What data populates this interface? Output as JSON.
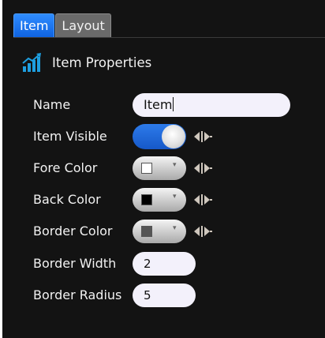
{
  "tabs": [
    {
      "label": "Item",
      "active": true
    },
    {
      "label": "Layout",
      "active": false
    }
  ],
  "section": {
    "title": "Item Properties",
    "icon": "chart-icon"
  },
  "fields": {
    "name": {
      "label": "Name",
      "value": "Item"
    },
    "item_visible": {
      "label": "Item Visible",
      "checked": true
    },
    "fore_color": {
      "label": "Fore Color",
      "color": "#ffffff"
    },
    "back_color": {
      "label": "Back Color",
      "color": "#000000"
    },
    "border_color": {
      "label": "Border Color",
      "color": "#555555"
    },
    "border_width": {
      "label": "Border Width",
      "value": "2"
    },
    "border_radius": {
      "label": "Border Radius",
      "value": "5"
    }
  },
  "colors": {
    "accent": "#1f6fe5",
    "icon": "#1e9fe0",
    "background": "#131313"
  }
}
